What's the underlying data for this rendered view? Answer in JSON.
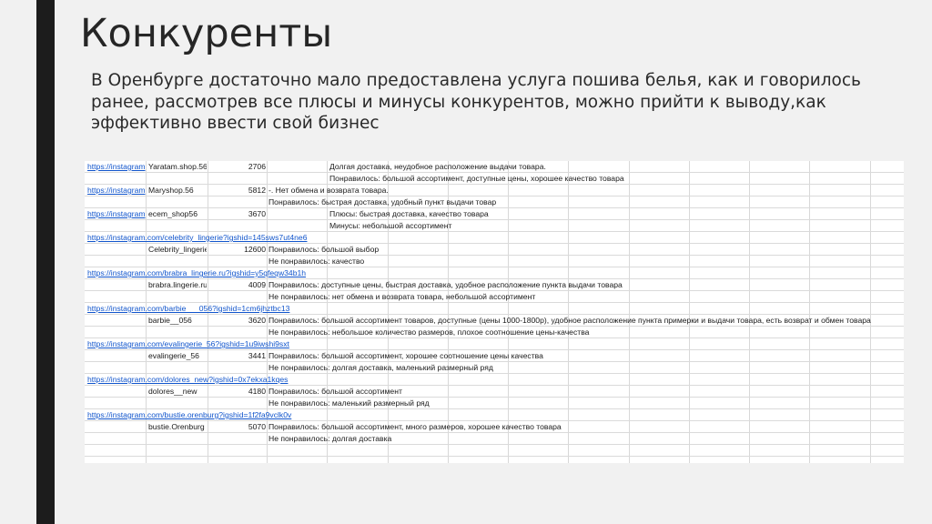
{
  "title": "Конкуренты",
  "intro": "В Оренбурге достаточно мало предоставлена услуга пошива белья, как и говорилось ранее, рассмотрев все плюсы и минусы конкурентов, можно прийти к выводу,как эффективно ввести свой бизнес",
  "rows": [
    {
      "a": "https://instagram",
      "b": "Yaratam.shop.56",
      "c": "2706",
      "d": "",
      "e": "Долгая доставка, неудобное расположение выдачи товара."
    },
    {
      "a": "",
      "b": "",
      "c": "",
      "d": "",
      "e": "Понравилось: большой ассортимент, доступные цены, хорошее качество товара"
    },
    {
      "a": "https://instagram",
      "b": "Maryshop.56",
      "c": "5812",
      "d": "-. Нет обмена и возврата товара.",
      "e": ""
    },
    {
      "a": "",
      "b": "",
      "c": "",
      "d": "Понравилось: быстрая доставка, удобный пункт выдачи товар",
      "e": ""
    },
    {
      "a": "https://instagram",
      "b": "ecem_shop56",
      "c": "3670",
      "d": "",
      "e": "Плюсы: быстрая доставка, качество товара"
    },
    {
      "a": "",
      "b": "",
      "c": "",
      "d": "",
      "e": "Минусы: небольшой ассортимент"
    },
    {
      "a": "https://instagram.com/celebrity_lingerie?igshid=145sws7ut4ne6",
      "b": "",
      "c": "",
      "d": "",
      "e": ""
    },
    {
      "a": "",
      "b": "Celebrity_lingerie",
      "c": "12600",
      "d": "Понравилось: большой выбор",
      "e": ""
    },
    {
      "a": "",
      "b": "",
      "c": "",
      "d": "Не понравилось: качество",
      "e": ""
    },
    {
      "a": "https://instagram.com/brabra_lingerie.ru?igshid=y5qfeqw34b1h",
      "b": "",
      "c": "",
      "d": "",
      "e": ""
    },
    {
      "a": "",
      "b": "brabra.lingerie.ru",
      "c": "4009",
      "d": "Понравилось: доступные цены, быстрая доставка, удобное расположение пункта выдачи товара",
      "e": ""
    },
    {
      "a": "",
      "b": "",
      "c": "",
      "d": "Не понравилось: нет обмена и возврата товара, небольшой ассортимент",
      "e": ""
    },
    {
      "a": "https://instagram.com/barbie___056?igshid=1cm6jhztbc13",
      "b": "",
      "c": "",
      "d": "",
      "e": ""
    },
    {
      "a": "",
      "b": "barbie__056",
      "c": "3620",
      "d": "Понравилось: большой ассортимент товаров, доступные (цены 1000-1800р), удобное расположение пункта примерки и выдачи товара, есть возврат и обмен товара",
      "e": ""
    },
    {
      "a": "",
      "b": "",
      "c": "",
      "d": "Не понравилось: небольшое количество размеров, плохое соотношение цены-качества",
      "e": ""
    },
    {
      "a": "https://instagram.com/evalingerie_56?igshid=1u9iwshi9sxt",
      "b": "",
      "c": "",
      "d": "",
      "e": ""
    },
    {
      "a": "",
      "b": "evalingerie_56",
      "c": "3441",
      "d": "Понравилось: большой ассортимент, хорошее соотношение цены качества",
      "e": ""
    },
    {
      "a": "",
      "b": "",
      "c": "",
      "d": "Не понравилось: долгая доставка, маленький размерный ряд",
      "e": ""
    },
    {
      "a": "https://instagram.com/dolores_new?igshid=0x7ekxa1kqes",
      "b": "",
      "c": "",
      "d": "",
      "e": ""
    },
    {
      "a": "",
      "b": "dolores__new",
      "c": "4180",
      "d": "Понравилось: большой ассортимент",
      "e": ""
    },
    {
      "a": "",
      "b": "",
      "c": "",
      "d": "Не понравилось: маленький размерный ряд",
      "e": ""
    },
    {
      "a": "https://instagram.com/bustie.orenburg?igshid=1f2fa9vclk0v",
      "b": "",
      "c": "",
      "d": "",
      "e": ""
    },
    {
      "a": "",
      "b": "bustie.Orenburg",
      "c": "5070",
      "d": "Понравилось: большой ассортимент, много размеров, хорошее качество товара",
      "e": ""
    },
    {
      "a": "",
      "b": "",
      "c": "",
      "d": "Не понравилось: долгая доставка",
      "e": ""
    },
    {
      "a": "",
      "b": "",
      "c": "",
      "d": "",
      "e": ""
    }
  ]
}
